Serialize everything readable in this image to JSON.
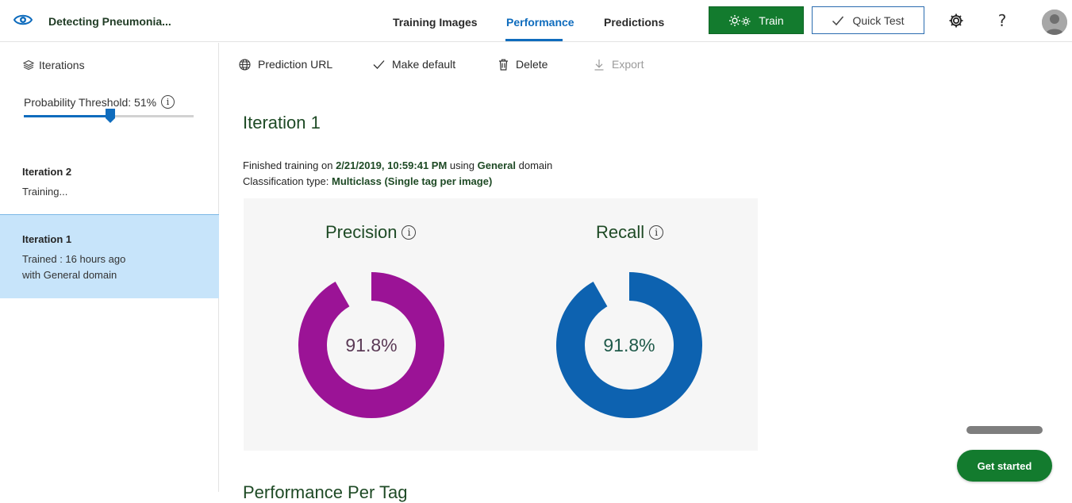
{
  "header": {
    "project_title": "Detecting Pneumonia...",
    "tabs": [
      {
        "label": "Training Images",
        "active": false
      },
      {
        "label": "Performance",
        "active": true
      },
      {
        "label": "Predictions",
        "active": false
      }
    ],
    "train_label": "Train",
    "quick_test_label": "Quick Test",
    "help_glyph": "?",
    "icons": {
      "logo": "eye-icon",
      "settings": "gear-icon",
      "help": "help-icon",
      "avatar": "user-avatar"
    }
  },
  "sidebar": {
    "heading": "Iterations",
    "threshold_label": "Probability Threshold: 51%",
    "threshold_value": 0.51,
    "iterations": [
      {
        "name": "Iteration 2",
        "line1": "Training...",
        "line2": "",
        "selected": false
      },
      {
        "name": "Iteration 1",
        "line1": "Trained : 16 hours ago",
        "line2": "with General domain",
        "selected": true
      }
    ]
  },
  "toolbar": {
    "prediction_url": "Prediction URL",
    "make_default": "Make default",
    "delete": "Delete",
    "export": "Export"
  },
  "main": {
    "iteration_title": "Iteration 1",
    "finished_prefix": "Finished training on ",
    "finished_date": "2/21/2019, 10:59:41 PM",
    "finished_using": " using ",
    "domain": "General",
    "finished_suffix": " domain",
    "classification_prefix": "Classification type: ",
    "classification_type": "Multiclass (Single tag per image)",
    "next_section_heading": "Performance Per Tag"
  },
  "metrics": {
    "precision": {
      "title": "Precision",
      "value": 0.918,
      "label": "91.8%",
      "color": "#9b1396"
    },
    "recall": {
      "title": "Recall",
      "value": 0.918,
      "label": "91.8%",
      "color": "#0d62b0"
    }
  },
  "floating": {
    "get_started": "Get started"
  },
  "colors": {
    "accent_green": "#137b2e",
    "accent_blue": "#0f6cbd",
    "heading_green": "#1e4a25",
    "selected_bg": "#c7e4fa"
  }
}
